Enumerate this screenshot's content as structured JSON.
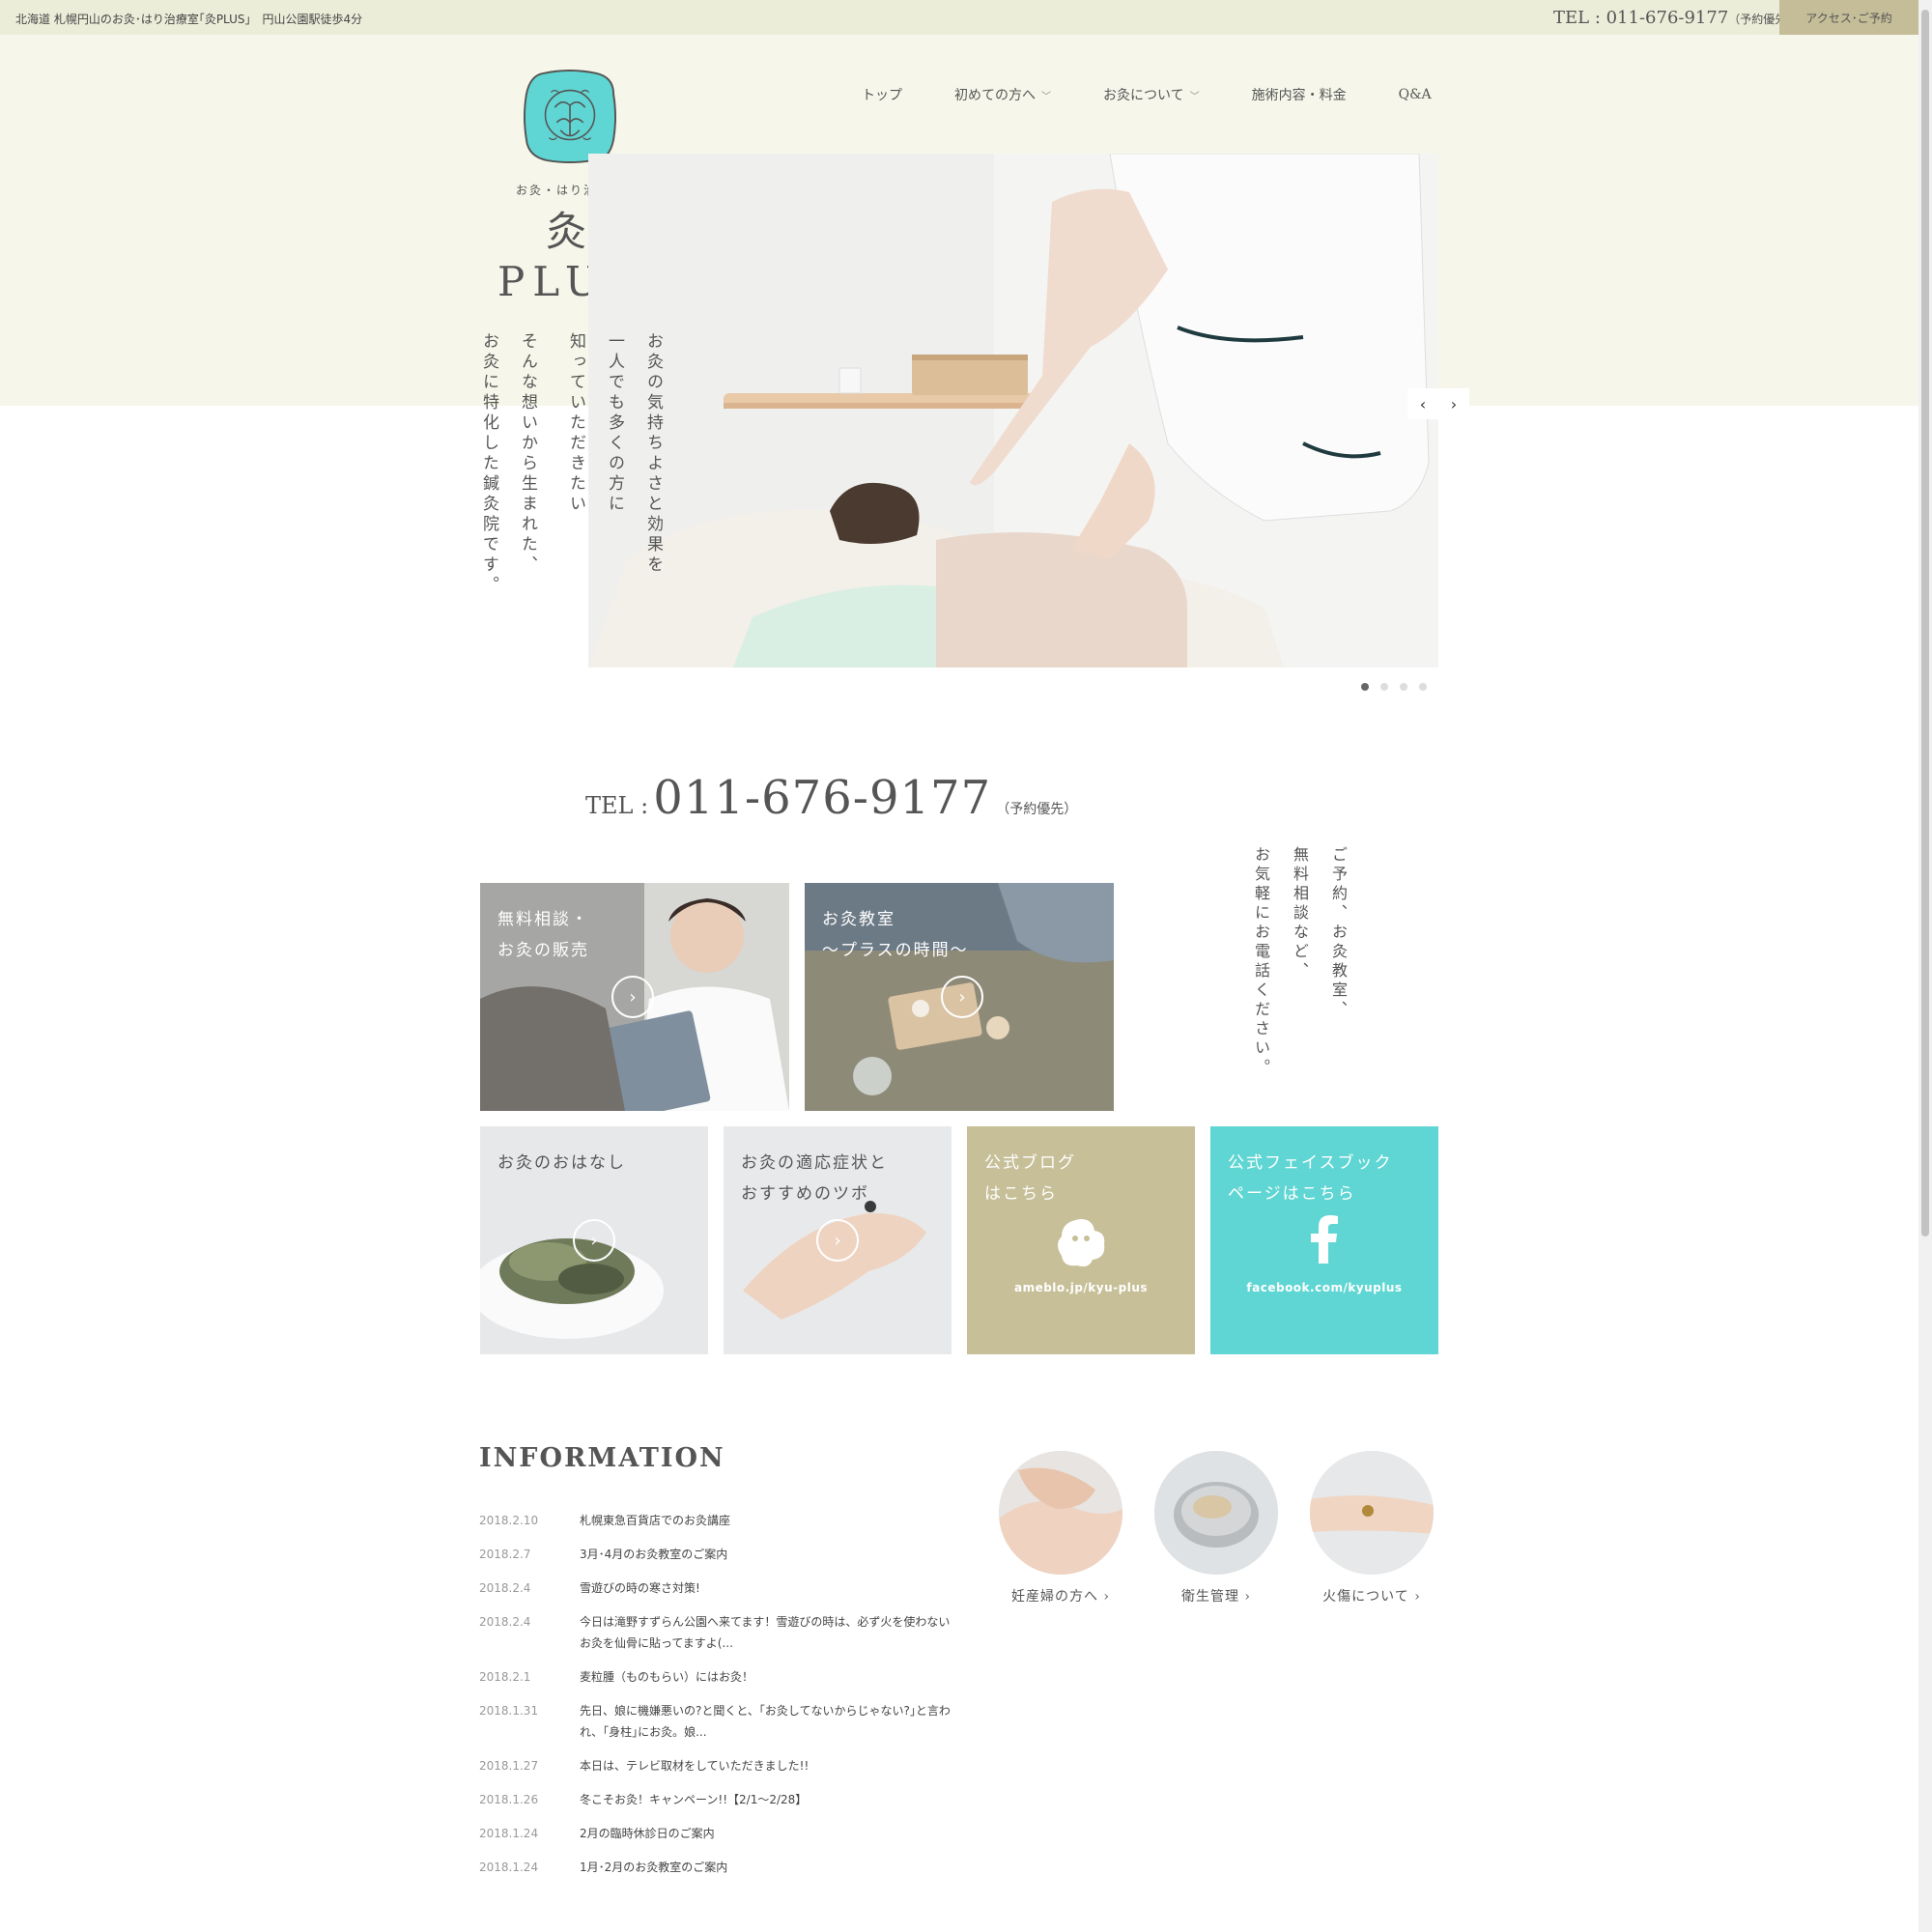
{
  "topbar": {
    "tagline": "北海道 札幌円山のお灸･はり治療室｢灸PLUS｣　円山公園駅徒歩4分",
    "tel": "TEL : 011-676-9177",
    "tel_note": "（予約優先）",
    "access": "アクセス･ご予約"
  },
  "logo": {
    "sub": "お灸・はり治療室",
    "name": "灸PLUS"
  },
  "nav": {
    "items": [
      {
        "label": "トップ",
        "has_menu": false
      },
      {
        "label": "初めての方へ",
        "has_menu": true
      },
      {
        "label": "お灸について",
        "has_menu": true
      },
      {
        "label": "施術内容・料金",
        "has_menu": false
      },
      {
        "label": "Q&A",
        "has_menu": false
      }
    ],
    "chevron": "﹀"
  },
  "hero": {
    "lines": [
      "お灸の気持ちよさと効果を",
      "一人でも多くの方に",
      "知っていただきたい",
      "そんな想いから生まれた、",
      "お灸に特化した鍼灸院です。"
    ],
    "prev": "‹",
    "next": "›",
    "slides": 4,
    "active_slide": 1
  },
  "contact": {
    "tel_label": "TEL :",
    "tel_number": "011-676-9177",
    "tel_note": "（予約優先）",
    "lines": [
      "ご予約、お灸教室、",
      "無料相談など、",
      "お気軽にお電話ください。"
    ]
  },
  "tiles": {
    "consult": {
      "line1": "無料相談・",
      "line2": "お灸の販売"
    },
    "class": {
      "line1": "お灸教室",
      "line2": "～プラスの時間～"
    },
    "story": {
      "line1": "お灸のおはなし"
    },
    "points": {
      "line1": "お灸の適応症状と",
      "line2": "おすすめのツボ"
    },
    "blog": {
      "line1": "公式ブログ",
      "line2": "はこちら",
      "url": "ameblo.jp/kyu-plus"
    },
    "facebook": {
      "line1": "公式フェイスブック",
      "line2": "ページはこちら",
      "url": "facebook.com/kyuplus"
    }
  },
  "arrow_glyph": "›",
  "information": {
    "title": "INFORMATION",
    "news": [
      {
        "date": "2018.2.10",
        "text": "札幌東急百貨店でのお灸講座"
      },
      {
        "date": "2018.2.7",
        "text": "3月･4月のお灸教室のご案内"
      },
      {
        "date": "2018.2.4",
        "text": "雪遊びの時の寒さ対策!"
      },
      {
        "date": "2018.2.4",
        "text": "今日は滝野すずらん公園へ来てます！雪遊びの時は、必ず火を使わないお灸を仙骨に貼ってますよ(..."
      },
      {
        "date": "2018.2.1",
        "text": "麦粒腫（ものもらい）にはお灸！"
      },
      {
        "date": "2018.1.31",
        "text": "先日、娘に機嫌悪いの?と聞くと、｢お灸してないからじゃない?｣と言われ、｢身柱｣にお灸。娘..."
      },
      {
        "date": "2018.1.27",
        "text": "本日は、テレビ取材をしていただきました!!"
      },
      {
        "date": "2018.1.26",
        "text": "冬こそお灸！キャンペーン!!【2/1～2/28】"
      },
      {
        "date": "2018.1.24",
        "text": "2月の臨時休診日のご案内"
      },
      {
        "date": "2018.1.24",
        "text": "1月･2月のお灸教室のご案内"
      }
    ]
  },
  "circles": [
    {
      "label": "妊産婦の方へ"
    },
    {
      "label": "衛生管理"
    },
    {
      "label": "火傷について"
    }
  ],
  "colors": {
    "topbar": "#ecedd9",
    "hero_bg": "#f6f7ea",
    "access_button": "#c5bd98",
    "blog_tile": "#c7bf98",
    "facebook_tile": "#5fd6d3",
    "logo_mark": "#5fd6d3"
  }
}
